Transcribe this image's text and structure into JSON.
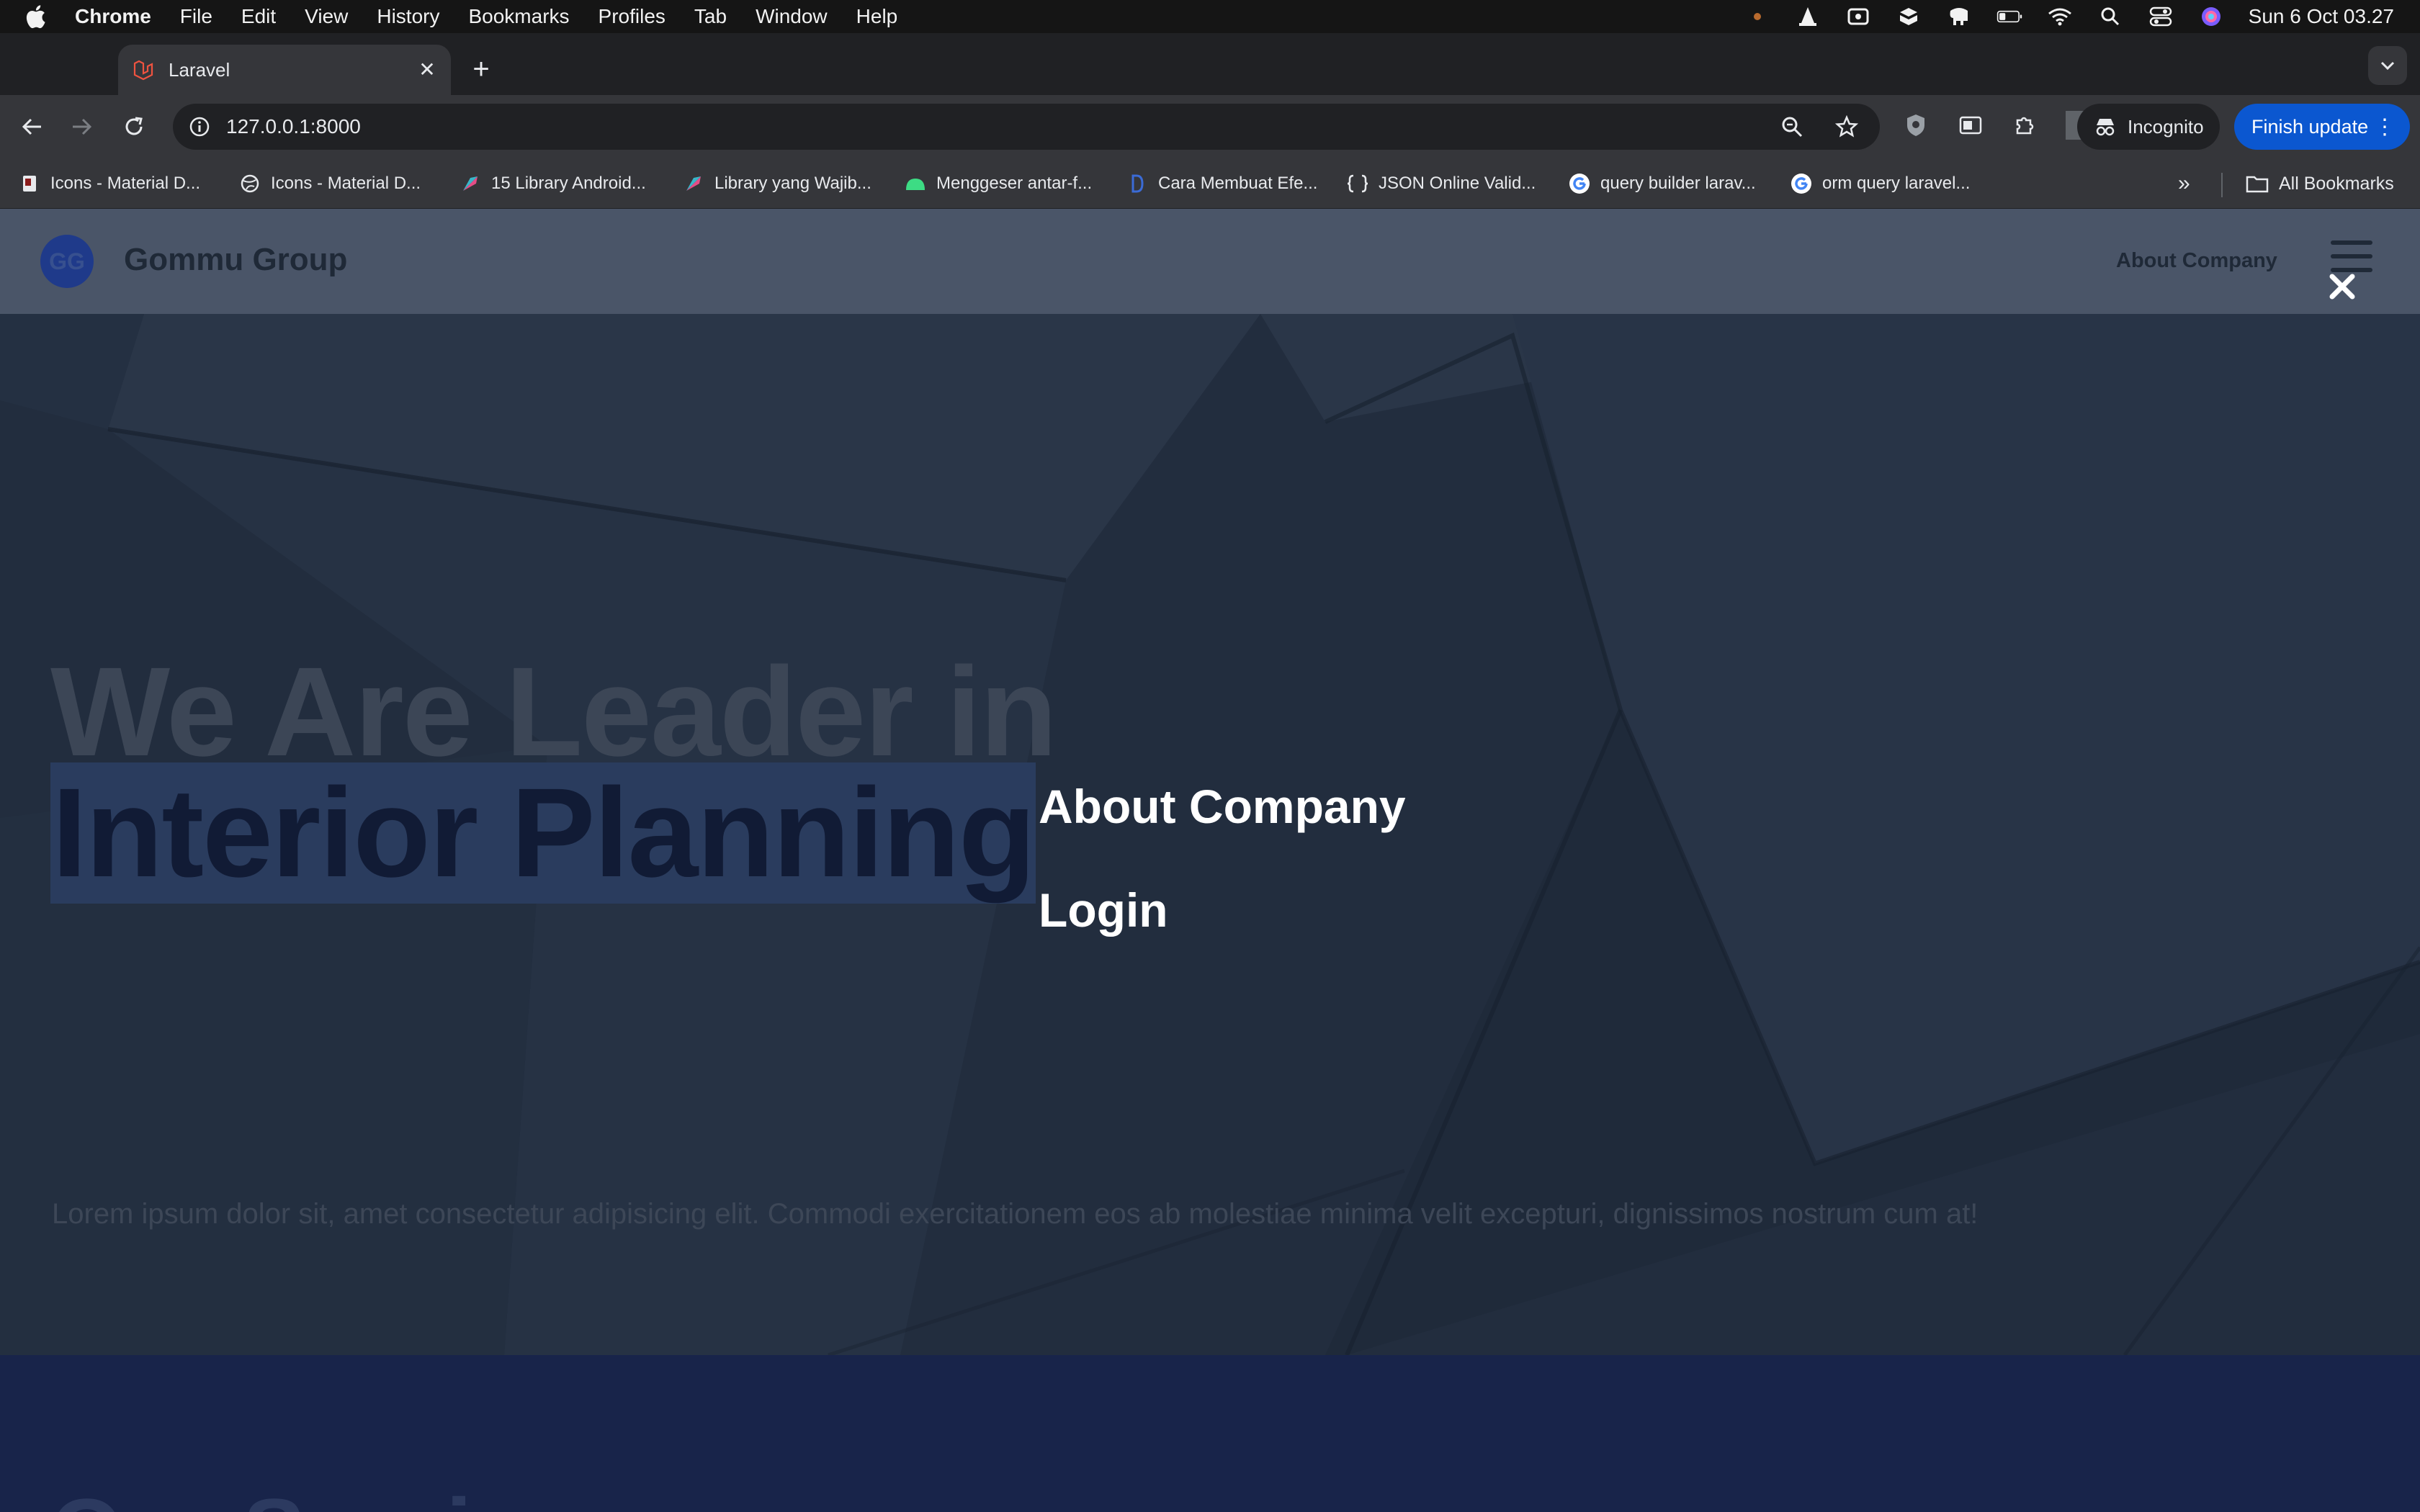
{
  "menubar": {
    "app": "Chrome",
    "items": [
      "File",
      "Edit",
      "View",
      "History",
      "Bookmarks",
      "Profiles",
      "Tab",
      "Window",
      "Help"
    ],
    "clock": "Sun 6 Oct  03.27"
  },
  "browser": {
    "tab_title": "Laravel",
    "url": "127.0.0.1:8000",
    "incognito_label": "Incognito",
    "finish_update_label": "Finish update"
  },
  "bookmarks": {
    "items": [
      "Icons - Material D...",
      "Icons - Material D...",
      "15 Library Android...",
      "Library yang Wajib...",
      "Menggeser antar-f...",
      "Cara Membuat Efe...",
      "JSON Online Valid...",
      "query builder larav...",
      "orm query laravel..."
    ],
    "all_label": "All Bookmarks"
  },
  "site": {
    "logo_initials": "GG",
    "brand": "Gommu Group",
    "nav_about": "About Company",
    "hero_line1": "We Are Leader in",
    "hero_line2": "Interior Planning",
    "hero_text": "Lorem ipsum dolor sit, amet consectetur adipisicing elit. Commodi exercitationem eos ab molestiae minima velit excepturi, dignissimos nostrum cum at!",
    "next_section_peek": "Our Services"
  },
  "overlay_menu": {
    "items": [
      "About Company",
      "Login"
    ]
  },
  "colors": {
    "nav_bg": "#4a5568",
    "hero_bg": "#243042",
    "highlight": "#2a3c5e",
    "finish_update": "#0b57d0"
  }
}
